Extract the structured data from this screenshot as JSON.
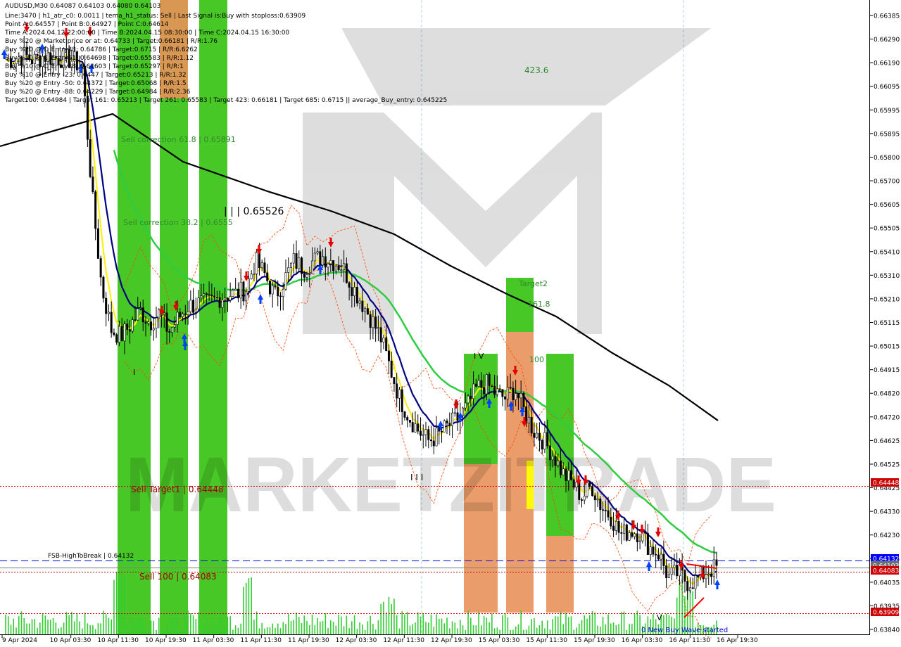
{
  "header": {
    "symbol_line": "AUDUSD,M30  0.64087 0.64103 0.64080 0.64103",
    "lines": [
      "Line:3470 | h1_atr_c0: 0.0011 | tema_h1_status: Sell | Last Signal is:Buy with stoploss:0.63909",
      "Point A:0.64557 | Point B:0.64927 | Point C:0.64614",
      "Time A:2024.04.12 22:00:00 | Time B:2024.04.15 08:30:00 | Time C:2024.04.15 16:30:00",
      "Buy %20 @ Market price or at: 0.64733 | Target:0.66181 | R/R:1.76",
      "Buy %20 @ C_Entry38: 0.64786 | Target:0.6715 | R/R:6.6262",
      "Buy %10 @ C_Entry61: 0.64698 | Target:0.65583 | R/R:1.12",
      "Buy %10 @ C_Entry88: 0.64603 | Target:0.65297 | R/R:1",
      "Buy %10 @ Entry -23: 0.6447 | Target:0.65213 | R/R:1.32",
      "Buy %20 @ Entry -50: 0.64372 | Target:0.65068 | R/R:1.5",
      "Buy %20 @ Entry -88: 0.64229 | Target:0.64984 | R/R:2.36",
      "Target100: 0.64984 | Target 161: 0.65213 | Target 261: 0.65583 | Target 423: 0.66181 | Target 685: 0.6715 || average_Buy_entry: 0.645225"
    ]
  },
  "annotations": {
    "sell_correction_618": "Sell correction 61.8 | 0.65891",
    "sell_correction_382": "Sell correction 38.2 | 0.6555",
    "high_marker": "| | | 0.65526",
    "label_4236": "423.6",
    "target2": "Target2",
    "label_1618": "161.8",
    "label_100": "100",
    "iv_marker": "I V",
    "iii_marker": "I I I",
    "i_marker": "I",
    "v_marker": "V",
    "sell_target1": "Sell Target1 | 0.64448",
    "fsb_high_to_break": "FSB-HighToBreak | 0.64132",
    "sell_100": "Sell 100 | 0.64083",
    "new_buy_wave": "0 New Buy Wave started"
  },
  "watermark": {
    "text": "MARKETZITRADE"
  },
  "colors": {
    "background": "#ffffff",
    "green_zone": "#3ec51a",
    "orange_zone": "#e8925a",
    "yellow_zone": "#ffff00",
    "candle": "#000000",
    "ma_black": "#000000",
    "ma_green": "#2ecc40",
    "ma_navy": "#000080",
    "ma_yellow": "#ffee00",
    "envelope": "#ff4500",
    "sell_arrow": "#e60000",
    "buy_arrow": "#0040ff",
    "volume": "#33cc33",
    "dashed_blue": "#0000ff",
    "dotted_red": "#cc0000",
    "label_red": "#a40000",
    "label_green": "#2f8a2f",
    "grid_cyan": "#a8d8d8"
  },
  "chart_data": {
    "type": "candlestick",
    "symbol": "AUDUSD",
    "timeframe": "M30",
    "ylim": [
      0.6384,
      0.6644
    ],
    "y_ticks": [
      "0.66385",
      "0.66290",
      "0.66190",
      "0.66095",
      "0.65995",
      "0.65895",
      "0.65800",
      "0.65700",
      "0.65605",
      "0.65505",
      "0.65410",
      "0.65310",
      "0.65210",
      "0.65115",
      "0.65015",
      "0.64915",
      "0.64820",
      "0.64720",
      "0.64625",
      "0.64525",
      "0.64425",
      "0.64330",
      "0.64230",
      "0.64135",
      "0.64035",
      "0.63935",
      "0.63840"
    ],
    "x_ticks": [
      "9 Apr 2024",
      "10 Apr 03:30",
      "10 Apr 11:30",
      "10 Apr 19:30",
      "11 Apr 03:30",
      "11 Apr 11:30",
      "11 Apr 19:30",
      "12 Apr 03:30",
      "12 Apr 11:30",
      "12 Apr 19:30",
      "15 Apr 03:30",
      "15 Apr 11:30",
      "15 Apr 19:30",
      "16 Apr 03:30",
      "16 Apr 11:30",
      "16 Apr 19:30"
    ],
    "close_series": [
      0.6625,
      0.6626,
      0.6627,
      0.6625,
      0.6627,
      0.6626,
      0.6626,
      0.6625,
      0.6622,
      0.6568,
      0.6529,
      0.6511,
      0.6508,
      0.6513,
      0.6519,
      0.6514,
      0.6518,
      0.651,
      0.6516,
      0.6521,
      0.6522,
      0.6522,
      0.6524,
      0.6526,
      0.6526,
      0.6528,
      0.654,
      0.6534,
      0.6525,
      0.6532,
      0.654,
      0.6537,
      0.654,
      0.6542,
      0.654,
      0.6538,
      0.653,
      0.6523,
      0.6516,
      0.6508,
      0.6495,
      0.6482,
      0.6474,
      0.6468,
      0.6464,
      0.6466,
      0.647,
      0.6473,
      0.6478,
      0.6486,
      0.6488,
      0.6484,
      0.6482,
      0.6486,
      0.6476,
      0.6468,
      0.6464,
      0.6458,
      0.645,
      0.6446,
      0.644,
      0.6445,
      0.6436,
      0.6432,
      0.6424,
      0.6426,
      0.6425,
      0.6419,
      0.6416,
      0.6406,
      0.6408,
      0.6404,
      0.6405,
      0.6409,
      0.641
    ],
    "price_lines": [
      {
        "label": "Sell Target1 | 0.64448",
        "value": 0.64448,
        "style": "dotted",
        "color": "#cc0000"
      },
      {
        "label": "FSB-HighToBreak | 0.64132",
        "value": 0.64132,
        "style": "dashed",
        "color": "#0000ff"
      },
      {
        "label": "Sell 100 | 0.64083",
        "value": 0.64083,
        "style": "dotted",
        "color": "#cc0000"
      },
      {
        "label": "current",
        "value": 0.64103,
        "style": "solid",
        "color": "#808080"
      },
      {
        "label": "stoploss",
        "value": 0.63909,
        "style": "dotted",
        "color": "#cc0000"
      }
    ],
    "price_badges": [
      {
        "value": "0.64448",
        "color": "#cc0000"
      },
      {
        "value": "0.64132",
        "color": "#0000ff"
      },
      {
        "value": "0.64103",
        "color": "#6f6f6f"
      },
      {
        "value": "0.64083",
        "color": "#cc0000"
      },
      {
        "value": "0.63909",
        "color": "#cc0000"
      }
    ],
    "zones": [
      {
        "x_start": 0.6665,
        "x_end": 0.6673,
        "y_low": 0.6386,
        "y_high": 0.6663,
        "color": "green"
      },
      {
        "x_start": 0.6705,
        "x_end": 0.6715,
        "y_low": 0.6386,
        "y_high": 0.6663,
        "color": "green"
      },
      {
        "x_start": 0.6705,
        "x_end": 0.6715,
        "y_low": 0.6629,
        "y_high": 0.6663,
        "color": "orange"
      },
      {
        "x_start": 0.6728,
        "x_end": 0.6738,
        "y_low": 0.6386,
        "y_high": 0.6663,
        "color": "green"
      }
    ]
  }
}
